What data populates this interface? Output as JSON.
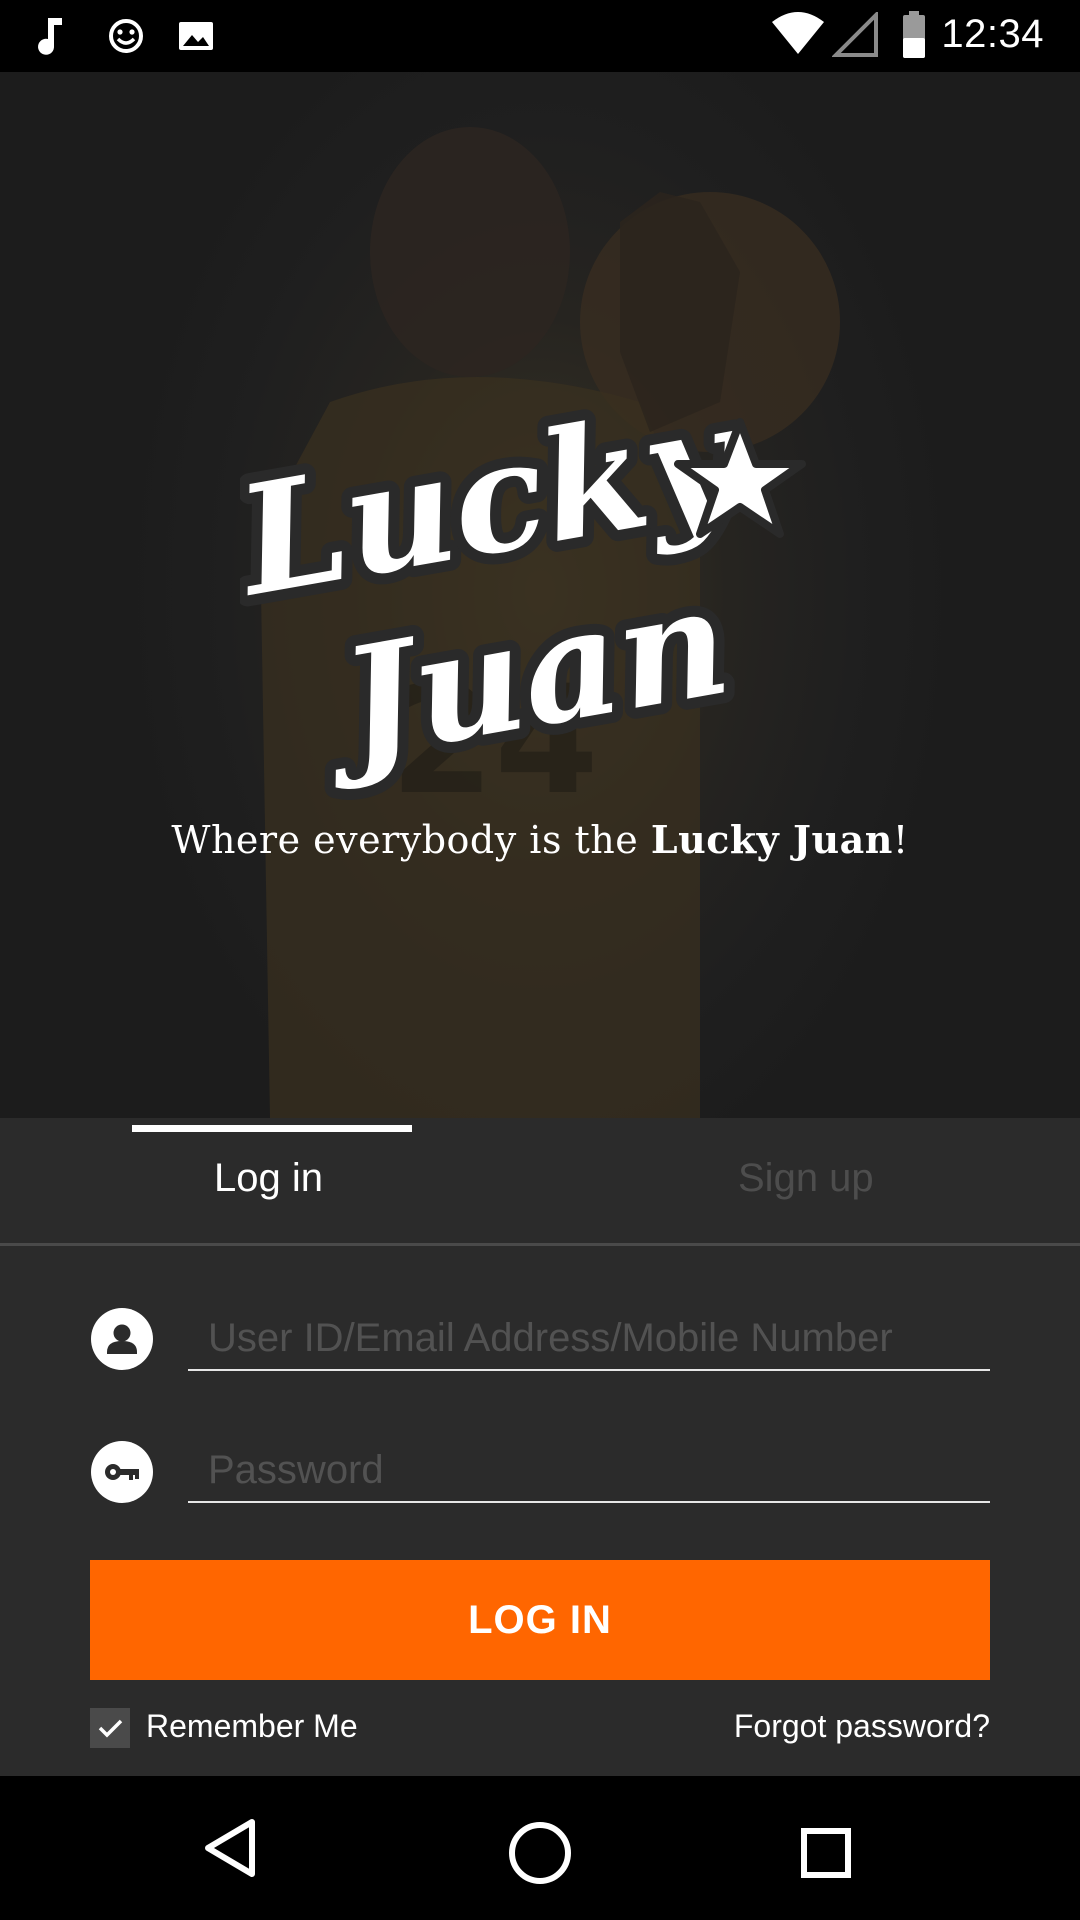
{
  "status_bar": {
    "time": "12:34",
    "left_icons": [
      "music-note-icon",
      "smiley-icon",
      "image-icon"
    ],
    "right_icons": [
      "wifi-icon",
      "cell-signal-icon",
      "battery-icon"
    ]
  },
  "hero": {
    "logo_text": "Lucky Juan",
    "tagline_prefix": "Where everybody is the ",
    "tagline_brand": "Lucky Juan",
    "tagline_suffix": "!"
  },
  "tabs": [
    {
      "label": "Log in",
      "active": true
    },
    {
      "label": "Sign up",
      "active": false
    }
  ],
  "form": {
    "user_placeholder": "User ID/Email Address/Mobile Number",
    "user_value": "",
    "password_placeholder": "Password",
    "password_value": "",
    "login_label": "LOG IN",
    "remember_label": "Remember Me",
    "remember_checked": true,
    "forgot_label": "Forgot password?"
  },
  "colors": {
    "accent": "#ff6600",
    "panel": "#2b2b2b",
    "placeholder": "#525252",
    "inactive_tab": "#4d4d4d"
  },
  "nav_bar": {
    "buttons": [
      "back-icon",
      "home-icon",
      "recents-icon"
    ]
  }
}
